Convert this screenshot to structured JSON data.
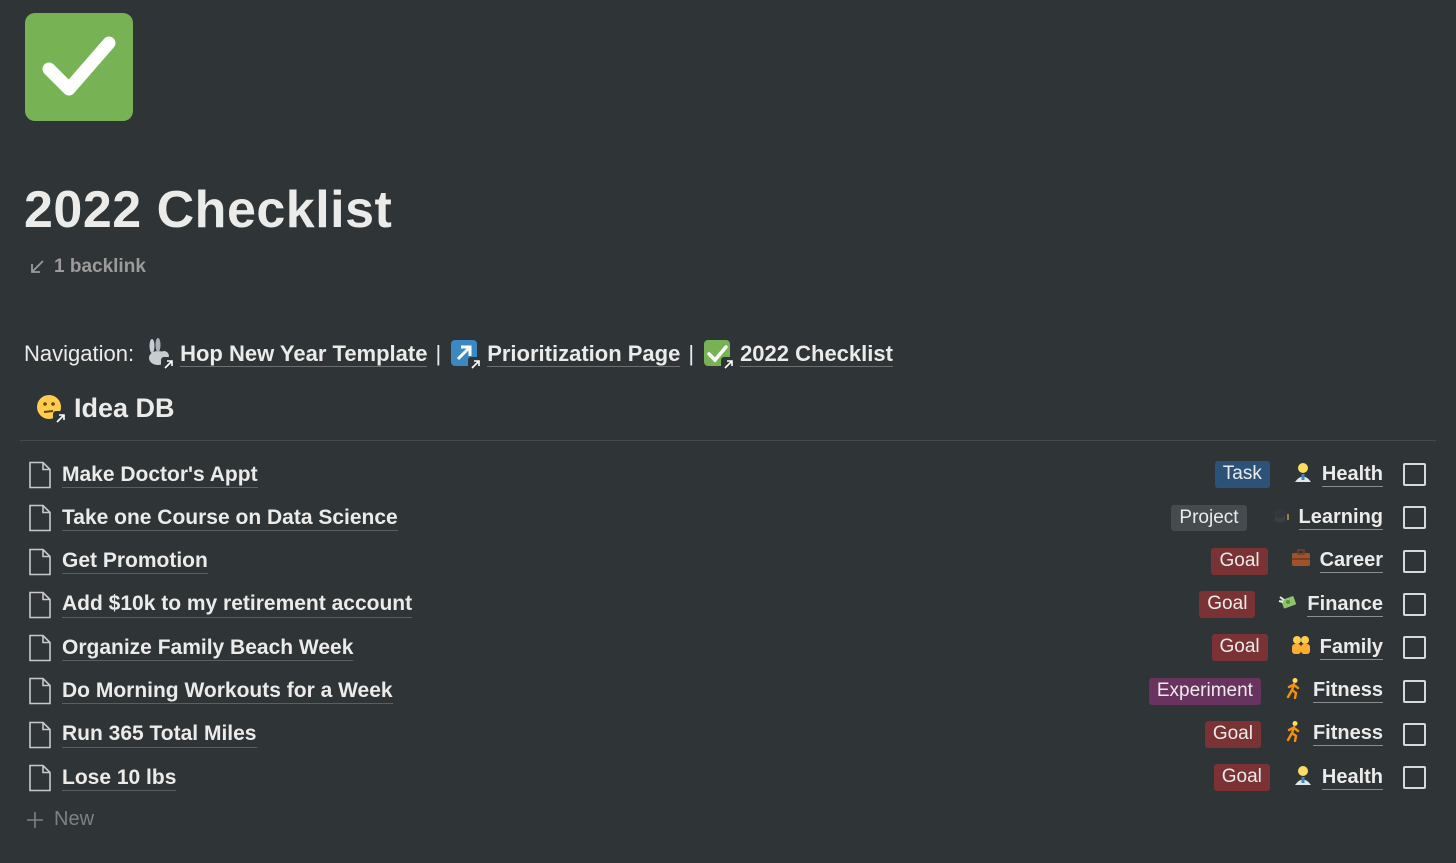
{
  "page": {
    "icon": "check-mark-button-icon",
    "title": "2022 Checklist",
    "backlink": "1 backlink"
  },
  "navigation": {
    "label": "Navigation:",
    "separator": "|",
    "links": [
      {
        "icon": "rabbit-icon",
        "label": "Hop New Year Template"
      },
      {
        "icon": "arrow-up-right-icon",
        "label": "Prioritization Page"
      },
      {
        "icon": "check-mark-button-icon",
        "label": "2022 Checklist"
      }
    ]
  },
  "database": {
    "icon": "thinking-face-icon",
    "title": "Idea DB",
    "rows": [
      {
        "name": "Make Doctor's Appt",
        "type": "Task",
        "type_color": "#2d5278",
        "area_icon": "health-worker-icon",
        "area": "Health",
        "checked": false
      },
      {
        "name": "Take one Course on Data Science",
        "type": "Project",
        "type_color": "#454b4e",
        "area_icon": "graduation-cap-icon",
        "area": "Learning",
        "checked": false
      },
      {
        "name": "Get Promotion",
        "type": "Goal",
        "type_color": "#7a3235",
        "area_icon": "briefcase-icon",
        "area": "Career",
        "checked": false
      },
      {
        "name": "Add $10k to my retirement account",
        "type": "Goal",
        "type_color": "#7a3235",
        "area_icon": "money-with-wings-icon",
        "area": "Finance",
        "checked": false
      },
      {
        "name": "Organize Family Beach Week",
        "type": "Goal",
        "type_color": "#7a3235",
        "area_icon": "family-icon",
        "area": "Family",
        "checked": false
      },
      {
        "name": "Do Morning Workouts for a Week",
        "type": "Experiment",
        "type_color": "#69335f",
        "area_icon": "person-running-icon",
        "area": "Fitness",
        "checked": false
      },
      {
        "name": "Run 365 Total Miles",
        "type": "Goal",
        "type_color": "#7a3235",
        "area_icon": "person-running-icon",
        "area": "Fitness",
        "checked": false
      },
      {
        "name": "Lose 10 lbs",
        "type": "Goal",
        "type_color": "#7a3235",
        "area_icon": "health-worker-icon",
        "area": "Health",
        "checked": false
      }
    ],
    "new_label": "New"
  }
}
